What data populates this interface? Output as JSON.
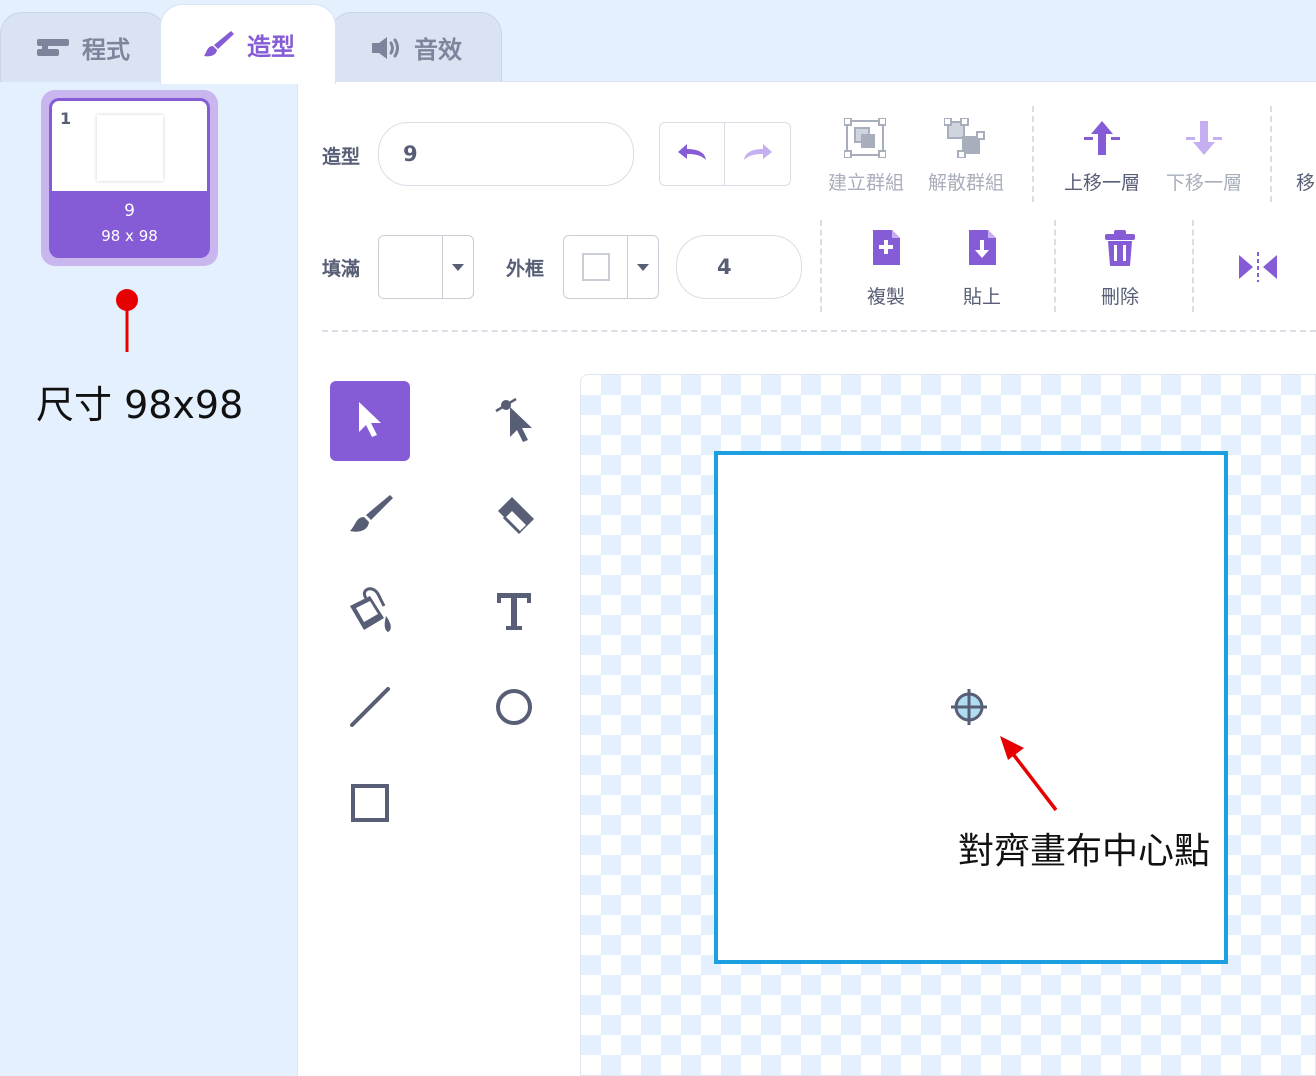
{
  "tabs": [
    {
      "label": "程式",
      "icon": "code-icon",
      "active": false
    },
    {
      "label": "造型",
      "icon": "brush-icon",
      "active": true
    },
    {
      "label": "音效",
      "icon": "speaker-icon",
      "active": false
    }
  ],
  "costume_list": {
    "items": [
      {
        "number": "1",
        "name": "9",
        "size": "98 x 98",
        "selected": true
      }
    ]
  },
  "toolbar": {
    "costume_label": "造型",
    "costume_name": "9",
    "group_label": "建立群組",
    "ungroup_label": "解散群組",
    "forward_label": "上移一層",
    "backward_label": "下移一層",
    "more_label": "移",
    "fill_label": "填滿",
    "outline_label": "外框",
    "outline_width": "4",
    "copy_label": "複製",
    "paste_label": "貼上",
    "delete_label": "刪除"
  },
  "tools": [
    {
      "name": "select",
      "icon": "arrow-pointer-icon",
      "selected": true
    },
    {
      "name": "reshape",
      "icon": "reshape-icon"
    },
    {
      "name": "brush",
      "icon": "brush-icon"
    },
    {
      "name": "eraser",
      "icon": "eraser-icon"
    },
    {
      "name": "fill",
      "icon": "paint-bucket-icon"
    },
    {
      "name": "text",
      "icon": "text-icon"
    },
    {
      "name": "line",
      "icon": "line-icon"
    },
    {
      "name": "circle",
      "icon": "circle-icon"
    },
    {
      "name": "rectangle",
      "icon": "rectangle-icon"
    }
  ],
  "annotations": {
    "size_note": "尺寸 98x98",
    "center_note": "對齊畫布中心點"
  },
  "colors": {
    "accent": "#855cd6",
    "canvas_border": "#1d9fe0",
    "annotation_red": "#e60000"
  }
}
